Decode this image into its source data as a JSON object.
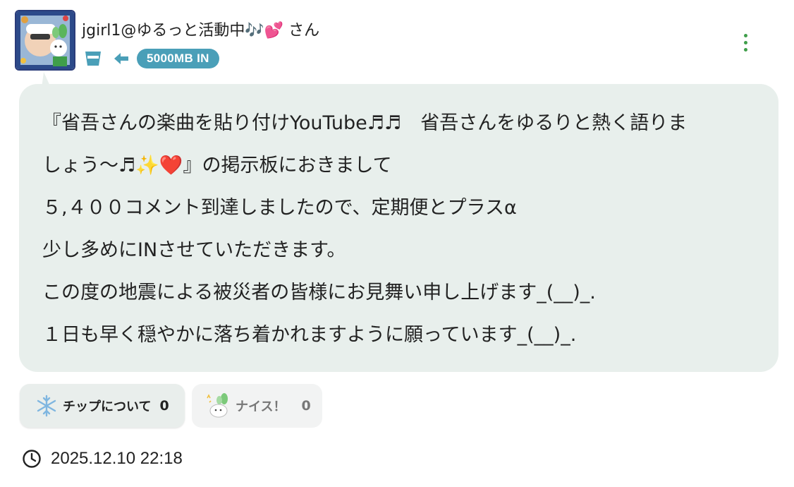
{
  "post": {
    "username": "jgirl1@ゆるっと活動中🎶💕 さん",
    "badge": "5000MB IN",
    "message_lines": [
      "『省吾さんの楽曲を貼り付けYouTube♬♬　省吾さんをゆるりと熱く語りま",
      "しょう〜♬✨❤️』の掲示板におきまして",
      "５,４００コメント到達しましたので、定期便とプラスα",
      "少し多めにINさせていただきます。",
      "この度の地震による被災者の皆様にお見舞い申し上げます_(__)_.",
      "１日も早く穏やかに落ち着かれますように願っています_(__)_."
    ],
    "reactions": {
      "tip": {
        "label": "チップについて",
        "count": "0"
      },
      "nice": {
        "label": "ナイス！",
        "count": "0"
      }
    },
    "timestamp": "2025.12.10 22:18"
  },
  "icons": {
    "header": [
      "avatar",
      "cup-icon",
      "arrow-left-icon",
      "kebab-menu-icon"
    ],
    "reactions": [
      "snowflake-icon",
      "nice-mascot-icon"
    ],
    "footer": [
      "clock-icon"
    ]
  },
  "colors": {
    "bubble": "#e8efec",
    "badge": "#4a9fb8",
    "accent_green": "#3f9e4a",
    "icon_blue": "#4a9fb8"
  }
}
